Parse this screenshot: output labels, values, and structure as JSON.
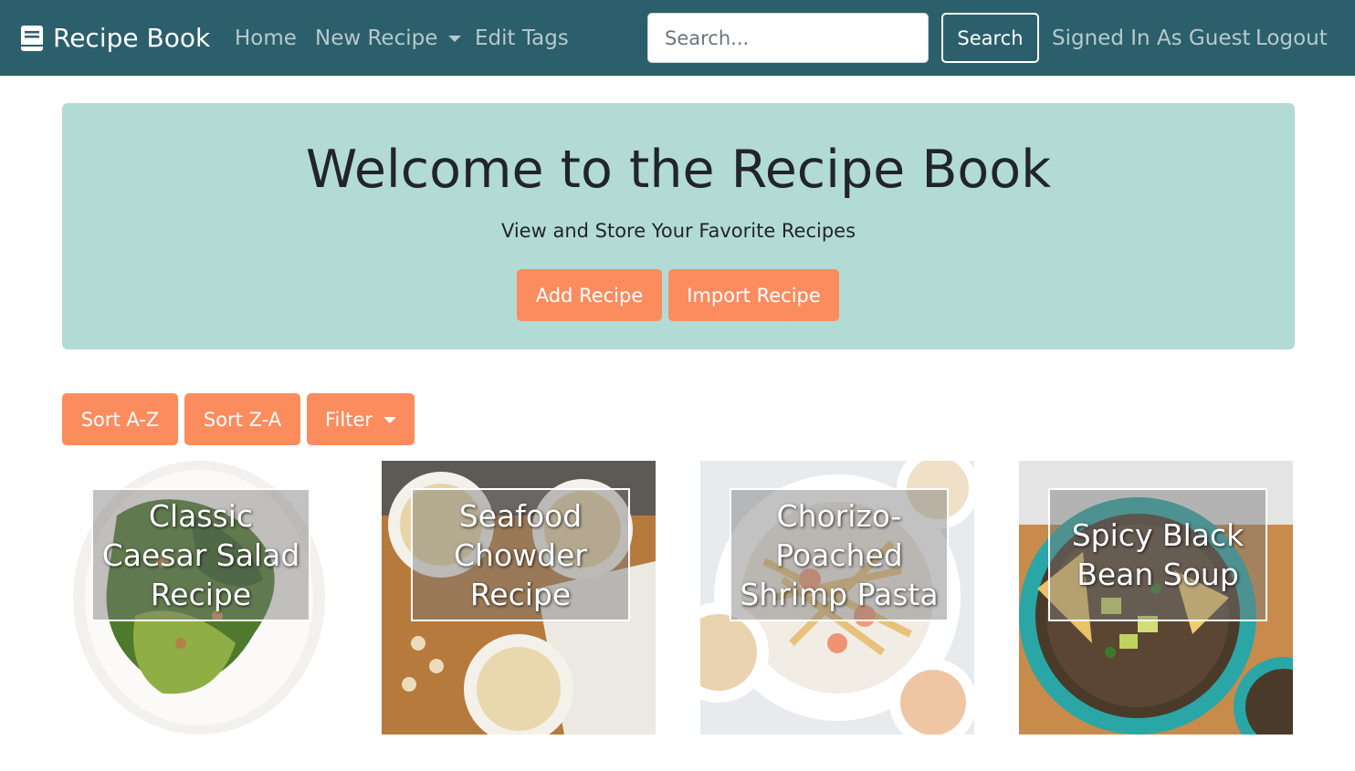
{
  "navbar": {
    "brand": "Recipe Book",
    "links": {
      "home": "Home",
      "new_recipe": "New Recipe",
      "edit_tags": "Edit Tags",
      "signed_in": "Signed In As Guest",
      "logout": "Logout"
    },
    "search": {
      "placeholder": "Search...",
      "button": "Search"
    }
  },
  "jumbotron": {
    "title": "Welcome to the Recipe Book",
    "subtitle": "View and Store Your Favorite Recipes",
    "add_button": "Add Recipe",
    "import_button": "Import Recipe"
  },
  "controls": {
    "sort_az": "Sort A-Z",
    "sort_za": "Sort Z-A",
    "filter": "Filter"
  },
  "recipes": [
    {
      "title": "Classic Caesar Salad Recipe"
    },
    {
      "title": "Seafood Chowder Recipe"
    },
    {
      "title": "Chorizo-Poached Shrimp Pasta"
    },
    {
      "title": "Spicy Black Bean Soup"
    }
  ],
  "colors": {
    "navbar": "#2b5f6b",
    "jumbotron": "#b3dbd6",
    "accent": "#fb8c5e"
  }
}
